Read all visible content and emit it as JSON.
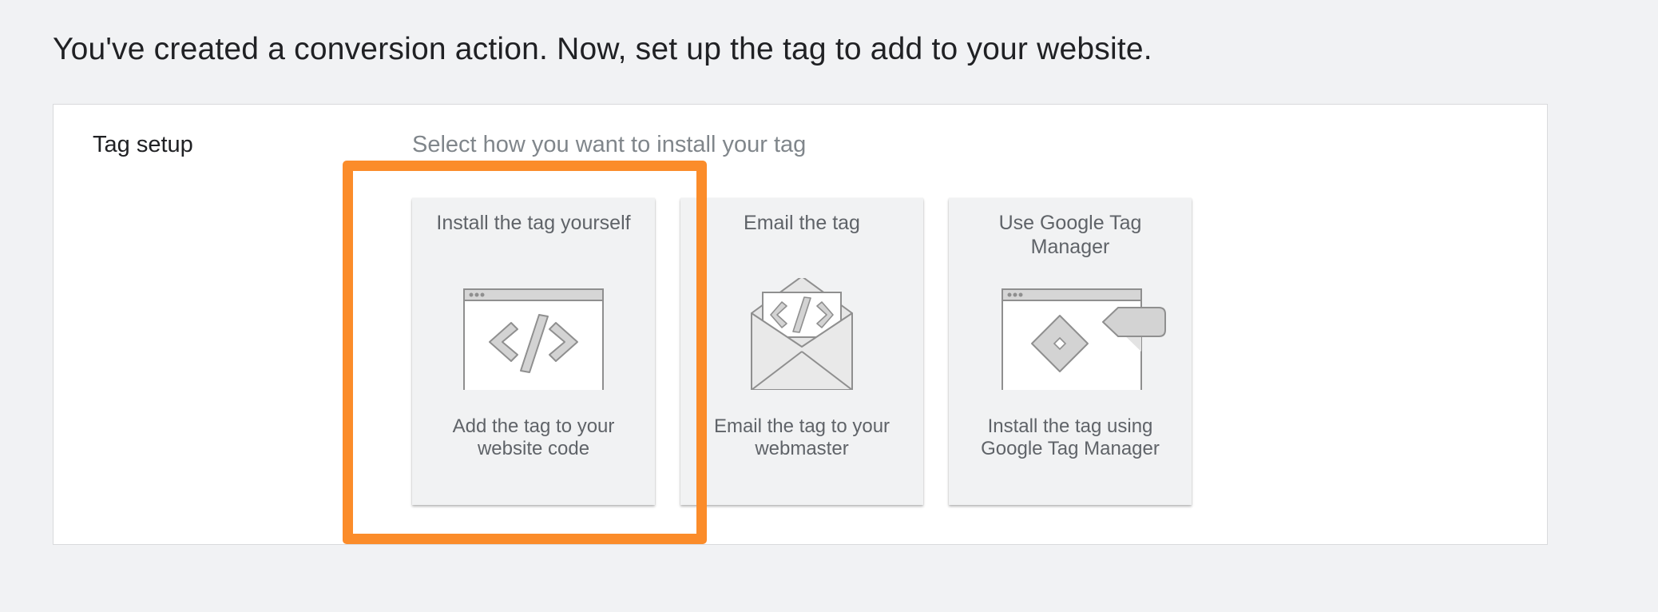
{
  "page": {
    "heading": "You've created a conversion action. Now, set up the tag to add to your website."
  },
  "tag_setup": {
    "label": "Tag setup",
    "prompt": "Select how you want to install your tag",
    "options": [
      {
        "title": "Install the tag yourself",
        "description": "Add the tag to your website code",
        "icon": "code-window-icon"
      },
      {
        "title": "Email the tag",
        "description": "Email the tag to your webmaster",
        "icon": "email-code-icon"
      },
      {
        "title": "Use Google Tag Manager",
        "description": "Install the tag using Google Tag Manager",
        "icon": "tag-manager-icon"
      }
    ]
  },
  "colors": {
    "highlight": "#fb8c2a",
    "background": "#f1f2f4",
    "card": "#f1f2f3"
  }
}
